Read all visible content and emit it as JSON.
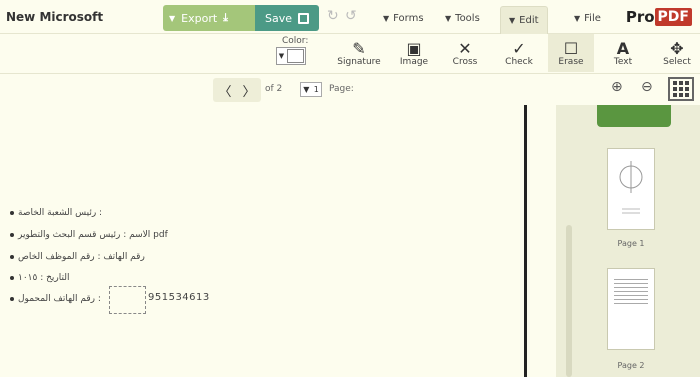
{
  "app": {
    "logo_pdf": "PDF",
    "logo_pro": "Pro",
    "doc_title": "New Microsoft"
  },
  "menu": {
    "file": "File",
    "edit": "Edit",
    "tools": "Tools",
    "forms": "Forms"
  },
  "actions": {
    "export_label": "Export",
    "save_label": "Save"
  },
  "toolbar": {
    "select": "Select",
    "text": "Text",
    "erase": "Erase",
    "check": "Check",
    "cross": "Cross",
    "image": "Image",
    "signature": "Signature",
    "color_label": "Color:"
  },
  "nav": {
    "page_label": "Page:",
    "current_page": "1",
    "of_text": "of 2"
  },
  "document": {
    "lines": [
      "رئيس الشعبة الخاصة :",
      "الاسم : رئيس قسم البحث والتطوير pdf",
      "رقم الهاتف : رقم الموظف الخاص",
      "التاريخ : ١٠١٥",
      "رقم الهاتف المحمول :"
    ],
    "phone_number": "951534613"
  },
  "sidebar": {
    "page1_label": "Page 1",
    "page2_label": "Page 2"
  },
  "colors": {
    "save_bg": "#4c9a86",
    "export_bg": "#a4c67a",
    "active_thumb": "#5a9640",
    "logo_red": "#c0392b"
  }
}
